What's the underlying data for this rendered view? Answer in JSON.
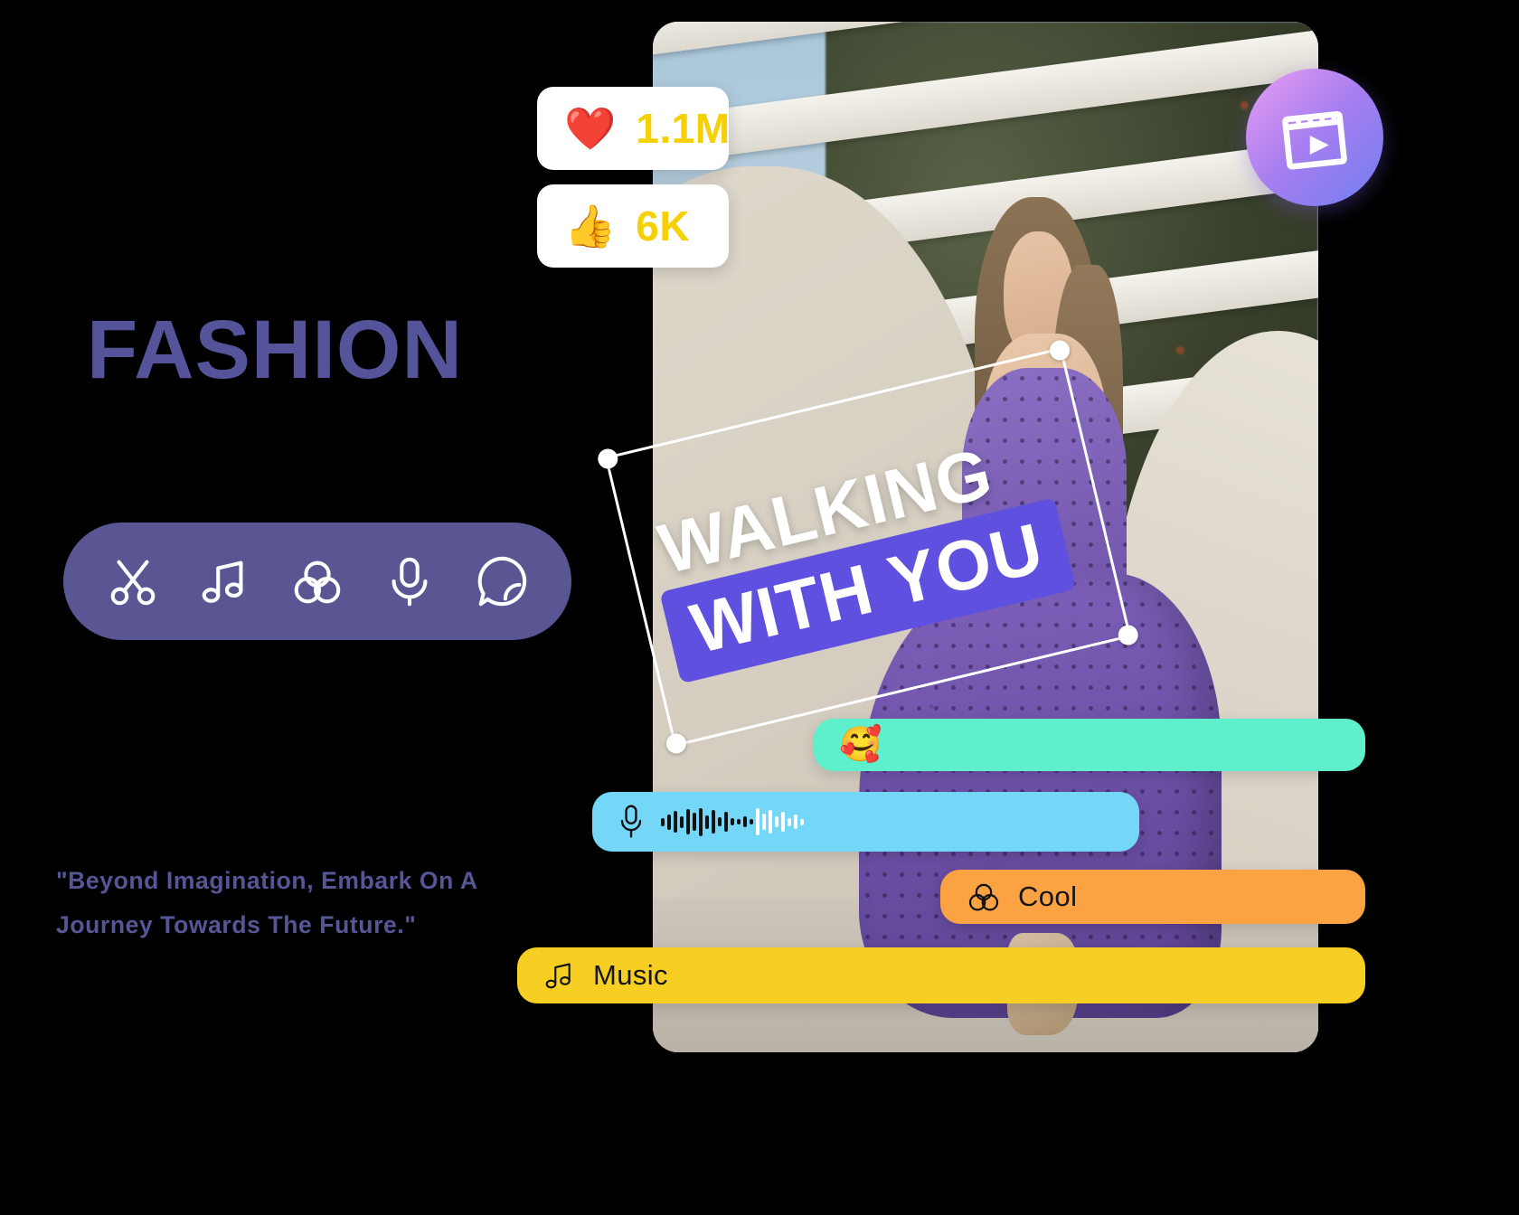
{
  "brand": {
    "title": "FASHION",
    "title_color": "#55549a",
    "quote": "\"Beyond Imagination, Embark On A Journey Towards The Future.\"",
    "quote_line_1": "\"Beyond Imagination, Embark On A",
    "quote_line_2": "Journey Towards The Future.\""
  },
  "toolbar": {
    "background_color": "#5a5694",
    "items": [
      {
        "icon": "scissors-icon",
        "name": "cut"
      },
      {
        "icon": "music-note-icon",
        "name": "music"
      },
      {
        "icon": "color-filter-icon",
        "name": "filter"
      },
      {
        "icon": "microphone-icon",
        "name": "voiceover"
      },
      {
        "icon": "sticker-icon",
        "name": "sticker"
      }
    ]
  },
  "badge": {
    "icon": "video-clapper-icon",
    "gradient_from": "#e89ef2",
    "gradient_to": "#6f7ef0"
  },
  "stats": [
    {
      "icon": "red-heart-emoji",
      "emoji": "❤️",
      "value": "1.1M",
      "value_color": "#f5d002"
    },
    {
      "icon": "thumbs-up-emoji",
      "emoji": "👍",
      "value": "6K",
      "value_color": "#f5d002"
    }
  ],
  "text_overlay": {
    "line_1": "WALKING",
    "line_2": "WITH YOU",
    "line_2_background": "#6050e0",
    "text_color": "#ffffff",
    "selected": true,
    "handles": 4
  },
  "feature_bars": [
    {
      "id": "sticker",
      "label": "",
      "emoji": "🥰",
      "color": "#5ef0cd",
      "icon": "smiling-face-with-hearts-emoji"
    },
    {
      "id": "voice",
      "label": "",
      "color": "#74d7f7",
      "icon": "microphone-icon"
    },
    {
      "id": "filter",
      "label": "Cool",
      "color": "#fba242",
      "icon": "color-filter-icon"
    },
    {
      "id": "music",
      "label": "Music",
      "color": "#f7cf22",
      "icon": "music-note-icon"
    }
  ]
}
